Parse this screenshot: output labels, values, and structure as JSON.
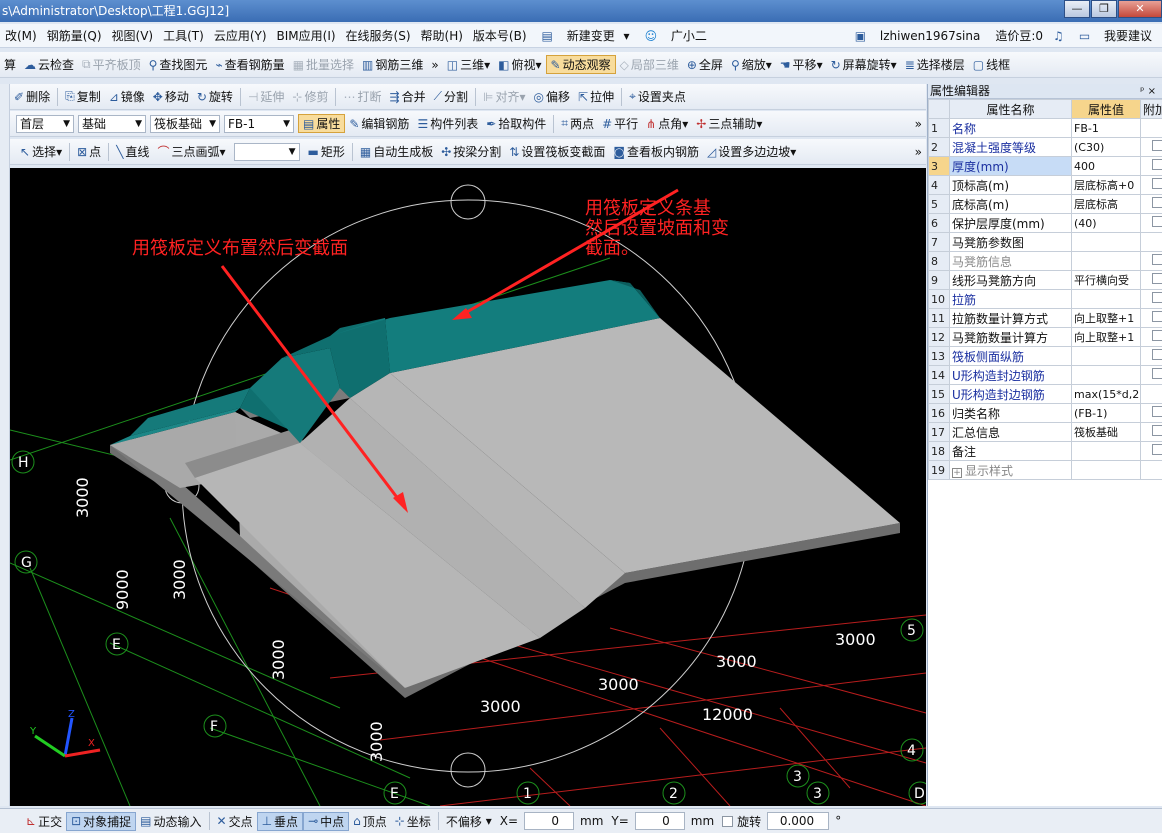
{
  "window": {
    "title": "s\\Administrator\\Desktop\\工程1.GGJ12]",
    "min": "—",
    "max": "❐",
    "close": "✕"
  },
  "menu": [
    "改(M)",
    "钢筋量(Q)",
    "视图(V)",
    "工具(T)",
    "云应用(Y)",
    "BIM应用(I)",
    "在线服务(S)",
    "帮助(H)",
    "版本号(B)"
  ],
  "menu_right": {
    "new_change": "新建变更",
    "assistant": "广小二",
    "user": "lzhiwen1967sina",
    "price": "造价豆:0",
    "suggest": "我要建议"
  },
  "toolbar1": {
    "calc": "算",
    "cloud_check": "云检查",
    "flush_board": "平齐板顶",
    "find": "查找图元",
    "view_rebar": "查看钢筋量",
    "batch_select": "批量选择",
    "rebar3d": "钢筋三维",
    "view3d": "三维",
    "top_view": "俯视",
    "dynamic": "动态观察",
    "local3d": "局部三维",
    "fullscreen": "全屏",
    "zoom": "缩放",
    "pan": "平移",
    "rotate_screen": "屏幕旋转",
    "select_floor": "选择楼层",
    "wire": "线框"
  },
  "toolbar2": {
    "delete": "删除",
    "copy": "复制",
    "mirror": "镜像",
    "move": "移动",
    "rotate": "旋转",
    "extend": "延伸",
    "trim": "修剪",
    "break": "打断",
    "merge": "合并",
    "split": "分割",
    "align": "对齐",
    "offset": "偏移",
    "stretch": "拉伸",
    "setpoint": "设置夹点"
  },
  "toolbar3": {
    "floor": "首层",
    "category": "基础",
    "type": "筏板基础",
    "member": "FB-1",
    "property": "属性",
    "edit_rebar": "编辑钢筋",
    "member_list": "构件列表",
    "pick": "拾取构件",
    "two_points": "两点",
    "parallel": "平行",
    "point_angle": "点角",
    "three_point_aux": "三点辅助"
  },
  "toolbar4": {
    "select": "选择",
    "point": "点",
    "line": "直线",
    "arc": "三点画弧",
    "rect": "矩形",
    "auto_gen": "自动生成板",
    "split_beam": "按梁分割",
    "set_section": "设置筏板变截面",
    "view_inner": "查看板内钢筋",
    "set_slope": "设置多边边坡"
  },
  "viewport": {
    "annotation1": "用筏板定义布置然后变截面",
    "annotation2_l1": "用筏板定义条基",
    "annotation2_l2": "然后设置坡面和变",
    "annotation2_l3": "截面。",
    "axis_labels": [
      "H",
      "G",
      "E",
      "F",
      "E",
      "1",
      "2",
      "3",
      "3",
      "4",
      "5",
      "D"
    ],
    "dims": [
      "3000",
      "9000",
      "3000",
      "3000",
      "3000",
      "3000",
      "3000",
      "3000",
      "3000",
      "12000",
      "3000"
    ],
    "triad": {
      "x": "X",
      "y": "Y",
      "z": "Z"
    }
  },
  "colors": {
    "teal": "#157a7a",
    "slab": "#b4b4b4",
    "annotation": "#ff2222",
    "grid_green": "#1c8f1c",
    "grid_red": "#b81d1d"
  },
  "props": {
    "title": "属性编辑器",
    "col_name": "属性名称",
    "col_val": "属性值",
    "col_add": "附加",
    "rows": [
      {
        "n": "1",
        "name": "名称",
        "val": "FB-1",
        "blue": true,
        "chk": false
      },
      {
        "n": "2",
        "name": "混凝土强度等级",
        "val": "(C30)",
        "blue": true,
        "chk": true
      },
      {
        "n": "3",
        "name": "厚度(mm)",
        "val": "400",
        "blue": true,
        "chk": true,
        "hl": true
      },
      {
        "n": "4",
        "name": "顶标高(m)",
        "val": "层底标高+0",
        "chk": true
      },
      {
        "n": "5",
        "name": "底标高(m)",
        "val": "层底标高",
        "chk": true
      },
      {
        "n": "6",
        "name": "保护层厚度(mm)",
        "val": "(40)",
        "chk": true
      },
      {
        "n": "7",
        "name": "马凳筋参数图",
        "val": "",
        "chk": false
      },
      {
        "n": "8",
        "name": "马凳筋信息",
        "val": "",
        "gray": true,
        "chk": true
      },
      {
        "n": "9",
        "name": "线形马凳筋方向",
        "val": "平行横向受",
        "chk": true
      },
      {
        "n": "10",
        "name": "拉筋",
        "val": "",
        "blue": true,
        "chk": true
      },
      {
        "n": "11",
        "name": "拉筋数量计算方式",
        "val": "向上取整+1",
        "chk": true
      },
      {
        "n": "12",
        "name": "马凳筋数量计算方",
        "val": "向上取整+1",
        "chk": true
      },
      {
        "n": "13",
        "name": "筏板侧面纵筋",
        "val": "",
        "blue": true,
        "chk": true
      },
      {
        "n": "14",
        "name": "U形构造封边钢筋",
        "val": "",
        "blue": true,
        "chk": true
      },
      {
        "n": "15",
        "name": "U形构造封边钢筋",
        "val": "max(15*d,2",
        "blue": true,
        "chk": false
      },
      {
        "n": "16",
        "name": "归类名称",
        "val": "(FB-1)",
        "chk": true
      },
      {
        "n": "17",
        "name": "汇总信息",
        "val": "筏板基础",
        "chk": true
      },
      {
        "n": "18",
        "name": "备注",
        "val": "",
        "chk": true
      },
      {
        "n": "19",
        "name": "显示样式",
        "val": "",
        "gray": true,
        "chk": false,
        "expand": true
      }
    ]
  },
  "status": {
    "ortho": "正交",
    "osnap": "对象捕捉",
    "dyn_input": "动态输入",
    "intersect": "交点",
    "perp": "垂点",
    "mid": "中点",
    "vertex": "顶点",
    "coord": "坐标",
    "offset_mode": "不偏移",
    "x_label": "X=",
    "x_val": "0",
    "mm1": "mm",
    "y_label": "Y=",
    "y_val": "0",
    "mm2": "mm",
    "rotate": "旋转",
    "rotate_val": "0.000",
    "deg": "°"
  }
}
